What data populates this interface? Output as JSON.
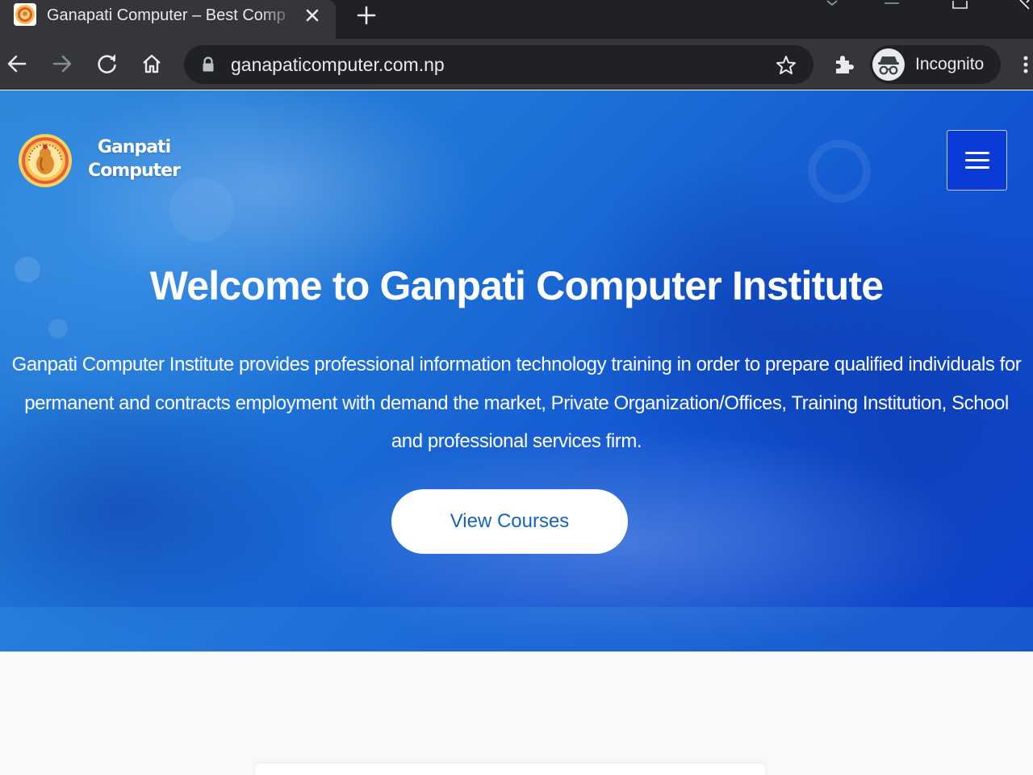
{
  "browser": {
    "tab": {
      "title": "Ganapati Computer – Best Comp"
    },
    "omnibox": {
      "url": "ganapaticomputer.com.np"
    },
    "profile": {
      "label": "Incognito"
    }
  },
  "page": {
    "brand": {
      "line1": "Ganpati",
      "line2": "Computer"
    },
    "hero": {
      "title": "Welcome to Ganpati Computer Institute",
      "description": "Ganpati Computer Institute provides professional information technology training in order to prepare qualified individuals for permanent and contracts employment with demand the market, Private Organization/Offices, Training Institution, School and professional services firm.",
      "cta_label": "View Courses"
    }
  },
  "colors": {
    "hero_blue": "#1866d4",
    "nav_toggle": "#0b3bd6",
    "cta_text": "#1565c0",
    "chrome_dark": "#202124",
    "chrome_toolbar": "#35363a"
  },
  "icons": [
    "favicon-icon",
    "close-icon",
    "plus-icon",
    "back-arrow-icon",
    "forward-arrow-icon",
    "reload-icon",
    "home-icon",
    "lock-icon",
    "star-icon",
    "puzzle-icon",
    "incognito-icon",
    "more-vert-icon",
    "hamburger-icon"
  ]
}
